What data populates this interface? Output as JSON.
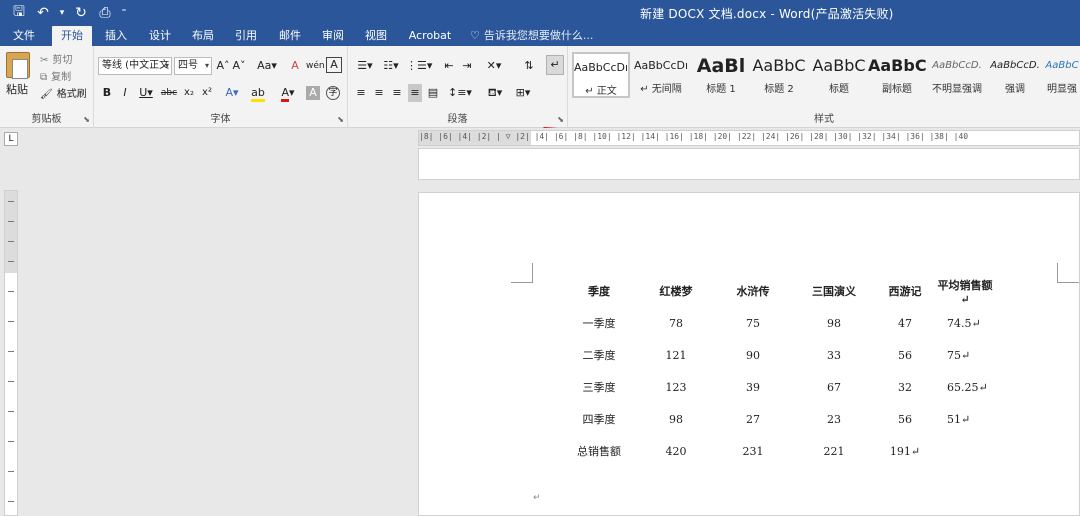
{
  "title": "新建 DOCX 文档.docx - Word(产品激活失败)",
  "tabs": [
    "文件",
    "开始",
    "插入",
    "设计",
    "布局",
    "引用",
    "邮件",
    "审阅",
    "视图",
    "Acrobat"
  ],
  "active_tab": "开始",
  "tell_me": "告诉我您想要做什么...",
  "clipboard": {
    "paste": "粘贴",
    "cut": "剪切",
    "copy": "复制",
    "format_painter": "格式刷",
    "label": "剪贴板"
  },
  "font": {
    "name": "等线 (中文正文",
    "size": "四号",
    "label": "字体"
  },
  "paragraph": {
    "label": "段落"
  },
  "styles": {
    "label": "样式",
    "items": [
      {
        "sample": "AaBbCcDı",
        "name": "↵ 正文"
      },
      {
        "sample": "AaBbCcDı",
        "name": "↵ 无间隔"
      },
      {
        "sample": "AaBl",
        "name": "标题 1"
      },
      {
        "sample": "AaBbC",
        "name": "标题 2"
      },
      {
        "sample": "AaBbC",
        "name": "标题"
      },
      {
        "sample": "AaBbC",
        "name": "副标题"
      },
      {
        "sample": "AaBbCcD.",
        "name": "不明显强调"
      },
      {
        "sample": "AaBbCcD.",
        "name": "强调"
      },
      {
        "sample": "AaBbC",
        "name": "明显强"
      }
    ]
  },
  "ruler": {
    "h_numbers": "|8| |6| |4| |2| | ▽ |2| |4| |6| |8| |10| |12| |14| |16| |18| |20| |22| |24| |26| |28| |30| |32| |34| |36| |38| |40",
    "corner": "L"
  },
  "table": {
    "headers": [
      "季度",
      "红楼梦",
      "水浒传",
      "三国演义",
      "西游记",
      "平均销售额↵"
    ],
    "rows": [
      [
        "一季度",
        "78",
        "75",
        "98",
        "47",
        "74.5↵"
      ],
      [
        "二季度",
        "121",
        "90",
        "33",
        "56",
        "75↵"
      ],
      [
        "三季度",
        "123",
        "39",
        "67",
        "32",
        "65.25↵"
      ],
      [
        "四季度",
        "98",
        "27",
        "23",
        "56",
        "51↵"
      ],
      [
        "总销售额",
        "420",
        "231",
        "221",
        "191↵",
        ""
      ]
    ]
  },
  "end_mark": "↵"
}
